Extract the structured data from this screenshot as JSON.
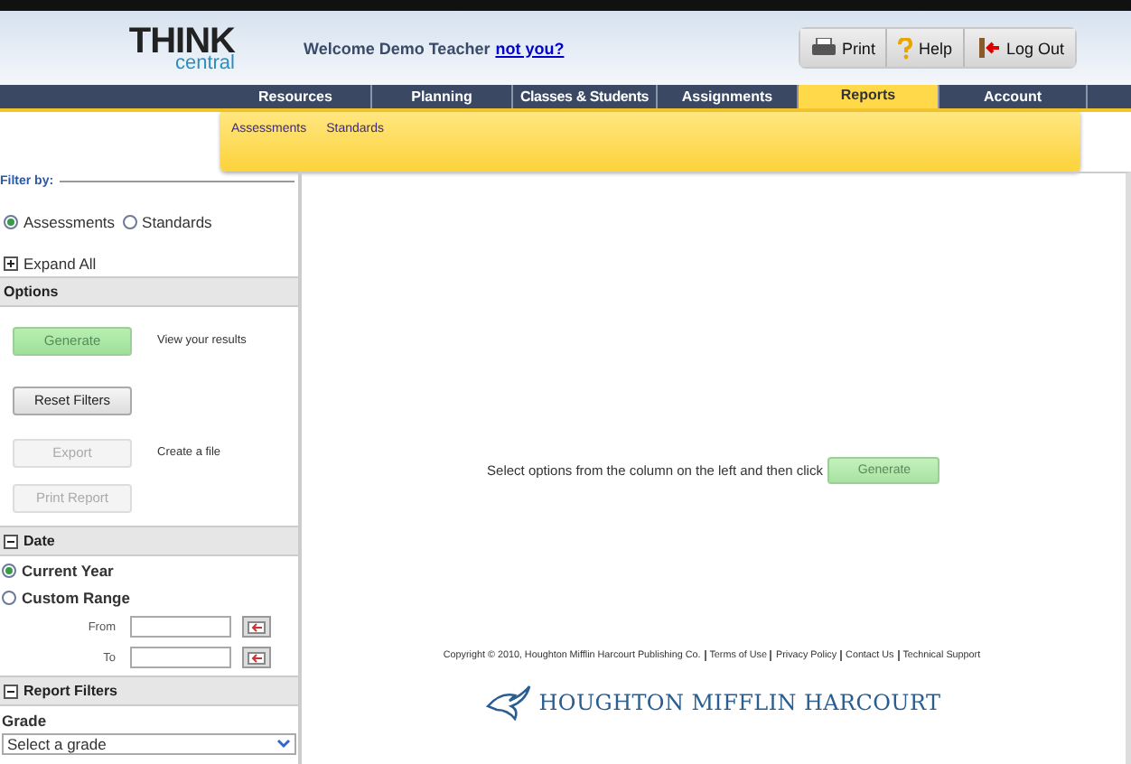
{
  "header": {
    "logo": {
      "word": "THINK",
      "sub": "central"
    },
    "welcome": "Welcome Demo Teacher",
    "link": "not you?",
    "tools": [
      {
        "kind": "print",
        "label": "Print"
      },
      {
        "kind": "help",
        "label": "Help"
      },
      {
        "kind": "logout",
        "label": "Log Out"
      }
    ]
  },
  "nav": {
    "tabs": [
      {
        "label": "Resources",
        "selected": false
      },
      {
        "label": "Planning",
        "selected": false
      },
      {
        "label": "Classes & Students",
        "selected": false
      },
      {
        "label": "Assignments",
        "selected": false
      },
      {
        "label": "Reports",
        "selected": true
      },
      {
        "label": "Account",
        "selected": false
      }
    ],
    "subnav": [
      "Assessments",
      "Standards"
    ]
  },
  "sidebar": {
    "filter_legend": "Filter by:",
    "filter_options": [
      {
        "label": "Assessments",
        "selected": true
      },
      {
        "label": "Standards",
        "selected": false
      }
    ],
    "expand_all": "Expand All",
    "options": {
      "title": "Options",
      "actions": [
        {
          "label": "Generate",
          "kind": "primary",
          "disabled": false,
          "hint": "View your results"
        },
        {
          "label": "Reset Filters",
          "kind": "normal",
          "disabled": false
        },
        {
          "label": "Export",
          "kind": "normal",
          "disabled": true,
          "hint": "Create a file"
        },
        {
          "label": "Print Report",
          "kind": "normal",
          "disabled": true
        }
      ]
    },
    "date": {
      "title": "Date",
      "expanded": true,
      "choices": [
        {
          "label": "Current Year",
          "selected": true
        },
        {
          "label": "Custom Range",
          "selected": false
        }
      ],
      "fields": [
        "From",
        "To"
      ]
    },
    "report_filters": {
      "title": "Report Filters",
      "expanded": true,
      "grade_label": "Grade",
      "grade_value": "Select a grade"
    }
  },
  "main": {
    "message": "Select options from the column on the left and then click",
    "button": "Generate",
    "copyright": "Copyright © 2010, Houghton Mifflin Harcourt Publishing Co.",
    "footer_links": [
      "Terms of Use",
      "Privacy Policy",
      "Contact Us",
      "Technical Support"
    ],
    "brand": "HOUGHTON MIFFLIN HARCOURT"
  }
}
